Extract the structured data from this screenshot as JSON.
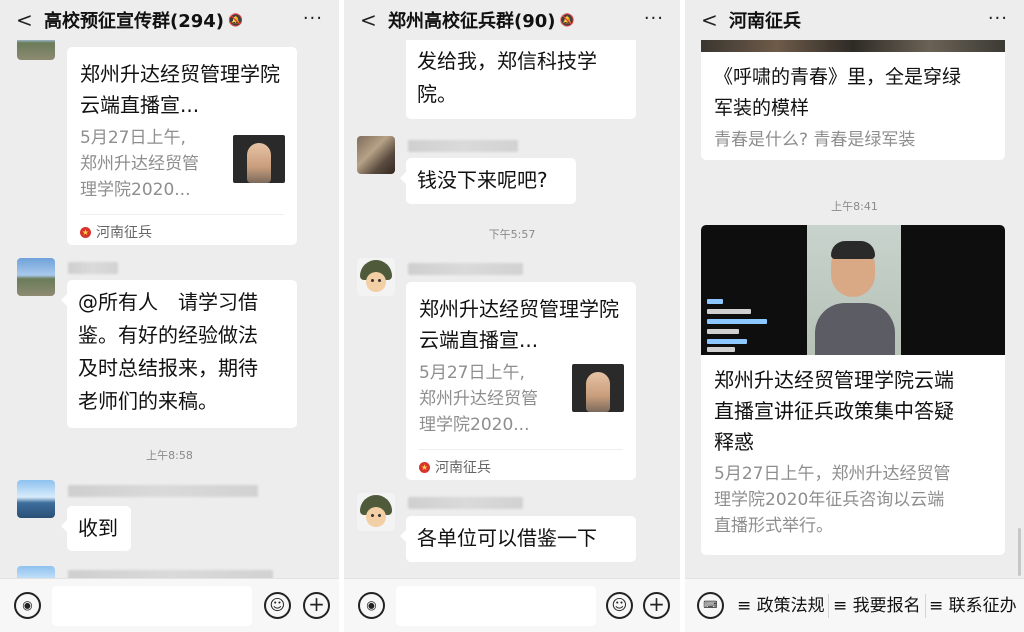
{
  "panel1": {
    "title": "高校预征宣传群(294)",
    "card": {
      "title": "郑州升达经贸管理学院云端直播宣...",
      "desc_line1": "5月27日上午,",
      "desc_line2": "郑州升达经贸管",
      "desc_line3": "理学院2020...",
      "source": "河南征兵"
    },
    "msg_all": [
      "@所有人　请学习借",
      "鉴。有好的经验做法",
      "及时总结报来，期待",
      "老师们的来稿。"
    ],
    "time1": "上午8:58",
    "msg_received": "收到"
  },
  "panel2": {
    "title": "郑州高校征兵群(90)",
    "msg_top": [
      "发给我，郑信科技学",
      "院。"
    ],
    "msg_money": "钱没下来呢吧?",
    "time1": "下午5:57",
    "card": {
      "title": "郑州升达经贸管理学院云端直播宣...",
      "desc_line1": "5月27日上午,",
      "desc_line2": "郑州升达经贸管",
      "desc_line3": "理学院2020...",
      "source": "河南征兵"
    },
    "msg_bottom": "各单位可以借鉴一下"
  },
  "panel3": {
    "title": "河南征兵",
    "top_card": {
      "title_line1": "《呼啸的青春》里，全是穿绿",
      "title_line2": "军装的模样",
      "desc": "青春是什么? 青春是绿军装"
    },
    "time1": "上午8:41",
    "video_card": {
      "title_line1": "郑州升达经贸管理学院云端",
      "title_line2": "直播宣讲征兵政策集中答疑",
      "title_line3": "释惑",
      "desc_line1": "5月27日上午，郑州升达经贸管",
      "desc_line2": "理学院2020年征兵咨询以云端",
      "desc_line3": "直播形式举行。"
    },
    "menu": [
      "≡ 政策法规",
      "≡ 我要报名",
      "≡ 联系征办"
    ]
  },
  "icons": {
    "back": "back-chevron-icon",
    "more": "more-dots-icon",
    "mute": "mute-bell-icon",
    "voice": "voice-icon",
    "emoji": "emoji-icon",
    "plus": "plus-icon",
    "keyboard": "keyboard-icon"
  },
  "colors": {
    "chat_bg": "#ededed",
    "bubble": "#ffffff",
    "source_icon": "#d8342b"
  }
}
